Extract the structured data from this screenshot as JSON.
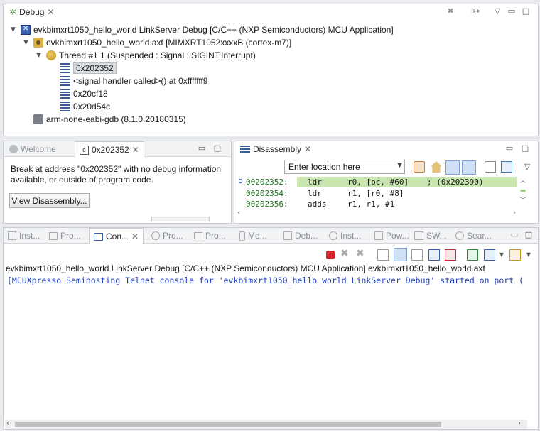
{
  "debug_view": {
    "tab_label": "Debug",
    "tree": {
      "launch": "evkbimxrt1050_hello_world LinkServer Debug [C/C++ (NXP Semiconductors) MCU Application]",
      "process": "evkbimxrt1050_hello_world.axf [MIMXRT1052xxxxB (cortex-m7)]",
      "thread": "Thread #1 1 (Suspended : Signal : SIGINT:Interrupt)",
      "frames": [
        "0x202352",
        "<signal handler called>() at 0xfffffff9",
        "0x20cf18",
        "0x20d54c"
      ],
      "gdb": "arm-none-eabi-gdb (8.1.0.20180315)"
    }
  },
  "editor_view": {
    "tabs": [
      "Welcome",
      "0x202352"
    ],
    "message": "Break at address \"0x202352\" with no debug information available, or outside of program code.",
    "button_label": "View Disassembly..."
  },
  "disassembly_view": {
    "tab_label": "Disassembly",
    "location_placeholder": "Enter location here",
    "lines": [
      {
        "addr": "00202352:",
        "op": "ldr",
        "args": "r0, [pc, #60]",
        "comment": "; (0x202390)",
        "current": true
      },
      {
        "addr": "00202354:",
        "op": "ldr",
        "args": "r1, [r0, #8]",
        "comment": "",
        "current": false
      },
      {
        "addr": "00202356:",
        "op": "adds",
        "args": "r1, r1, #1",
        "comment": "",
        "current": false
      }
    ]
  },
  "bottom_tabs": [
    "Inst...",
    "Pro...",
    "Con...",
    "Pro...",
    "Pro...",
    "Me...",
    "Deb...",
    "Inst...",
    "Pow...",
    "SW...",
    "Sear..."
  ],
  "console": {
    "header": "evkbimxrt1050_hello_world LinkServer Debug [C/C++ (NXP Semiconductors) MCU Application] evkbimxrt1050_hello_world.axf",
    "output": "[MCUXpresso Semihosting Telnet console for 'evkbimxrt1050_hello_world LinkServer Debug' started on port ("
  },
  "colors": {
    "accent": "#3a5fb0",
    "current_line": "#c9e6b0",
    "console_text": "#1f3fbf",
    "address_green": "#1a7a1a"
  },
  "icons": [
    "debug-icon",
    "launch-config-icon",
    "process-icon",
    "thread-icon",
    "stack-frame-icon",
    "gdb-icon",
    "terminate-icon",
    "remove-launches-icon",
    "step-icon",
    "view-menu-icon",
    "minimize-icon",
    "maximize-icon"
  ]
}
